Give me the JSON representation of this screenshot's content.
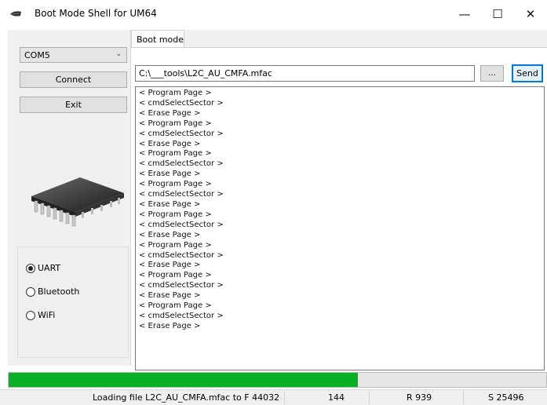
{
  "window": {
    "title": "Boot Mode Shell for UM64",
    "minimize": "—",
    "maximize": "☐",
    "close": "✕"
  },
  "sidebar": {
    "port": "COM5",
    "connect_label": "Connect",
    "exit_label": "Exit",
    "radios": [
      {
        "label": "UART",
        "checked": true
      },
      {
        "label": "Bluetooth",
        "checked": false
      },
      {
        "label": "WiFi",
        "checked": false
      }
    ]
  },
  "main": {
    "tab_label": "Boot mode",
    "path_value": "C:\\___tools\\L2C_AU_CMFA.mfac",
    "browse_label": "...",
    "send_label": "Send",
    "log": [
      "< Program Page >",
      "< cmdSelectSector >",
      "< Erase Page >",
      "< Program Page >",
      "< cmdSelectSector >",
      "< Erase Page >",
      "< Program Page >",
      "< cmdSelectSector >",
      "< Erase Page >",
      "< Program Page >",
      "< cmdSelectSector >",
      "< Erase Page >",
      "< Program Page >",
      "< cmdSelectSector >",
      "< Erase Page >",
      "< Program Page >",
      "< cmdSelectSector >",
      "< Erase Page >",
      "< Program Page >",
      "< cmdSelectSector >",
      "< Erase Page >",
      "< Program Page >",
      "< cmdSelectSector >",
      "< Erase Page >"
    ]
  },
  "progress": {
    "percent": 65,
    "color": "#06b025"
  },
  "status": {
    "loading": "Loading file L2C_AU_CMFA.mfac to F 44032",
    "count": "144",
    "received": "R 939",
    "sent": "S 25496"
  }
}
